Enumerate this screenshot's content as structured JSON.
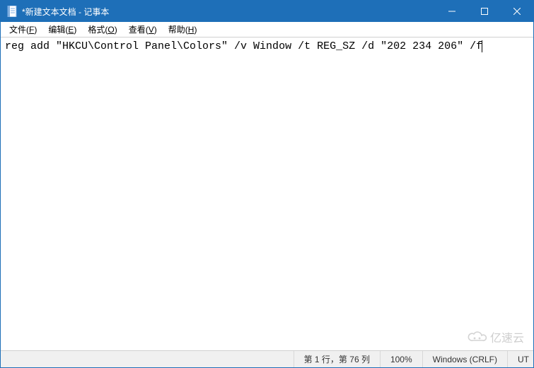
{
  "titlebar": {
    "icon": "notepad-icon",
    "title": "*新建文本文档 - 记事本"
  },
  "window_controls": {
    "minimize": "minimize-icon",
    "maximize": "maximize-icon",
    "close": "close-icon"
  },
  "menubar": {
    "items": [
      {
        "label": "文件",
        "accel": "F"
      },
      {
        "label": "编辑",
        "accel": "E"
      },
      {
        "label": "格式",
        "accel": "O"
      },
      {
        "label": "查看",
        "accel": "V"
      },
      {
        "label": "帮助",
        "accel": "H"
      }
    ]
  },
  "editor": {
    "content": "reg add \"HKCU\\Control Panel\\Colors\" /v Window /t REG_SZ /d \"202 234 206\" /f"
  },
  "statusbar": {
    "position": "第 1 行，第 76 列",
    "zoom": "100%",
    "line_ending": "Windows (CRLF)",
    "encoding": "UT"
  },
  "watermark": {
    "text": "亿速云"
  },
  "colors": {
    "titlebar_bg": "#1e6fb8"
  }
}
